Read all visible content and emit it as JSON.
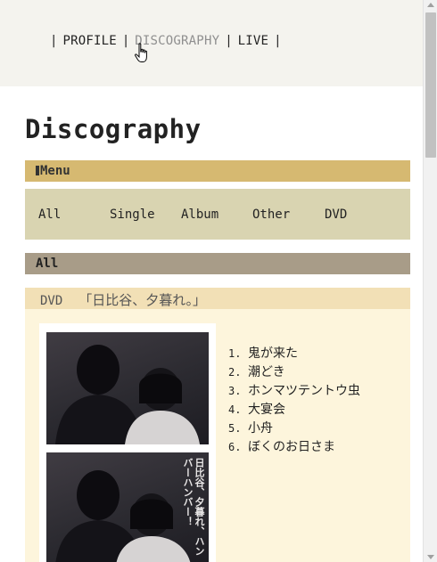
{
  "nav": {
    "items": [
      {
        "label": "PROFILE",
        "active": false
      },
      {
        "label": "DISCOGRAPHY",
        "active": true
      },
      {
        "label": "LIVE",
        "active": false
      }
    ],
    "separator": "|"
  },
  "page": {
    "title": "Discography"
  },
  "menu": {
    "header": "Menu",
    "links": [
      "All",
      "Single",
      "Album",
      "Other",
      "DVD"
    ]
  },
  "section": {
    "header": "All"
  },
  "release": {
    "type": "DVD",
    "title": "「日比谷、夕暮れ。」",
    "cover_text": "日比谷、夕暮れ、ハンバーハンバー！",
    "tracks": [
      {
        "num": "1.",
        "title": "鬼が来た"
      },
      {
        "num": "2.",
        "title": "潮どき"
      },
      {
        "num": "3.",
        "title": "ホンマツテントウ虫"
      },
      {
        "num": "4.",
        "title": "大宴会"
      },
      {
        "num": "5.",
        "title": "小舟"
      },
      {
        "num": "6.",
        "title": "ぼくのお日さま"
      }
    ]
  },
  "colors": {
    "header_bg": "#f4f3ee",
    "menu_bar": "#d6b971",
    "menu_box": "#d9d4b1",
    "all_bar": "#a89c88",
    "release_head": "#f2e0b6",
    "release_body": "#fdf5dc"
  },
  "icons": {
    "cursor": "hand-pointer-icon"
  }
}
